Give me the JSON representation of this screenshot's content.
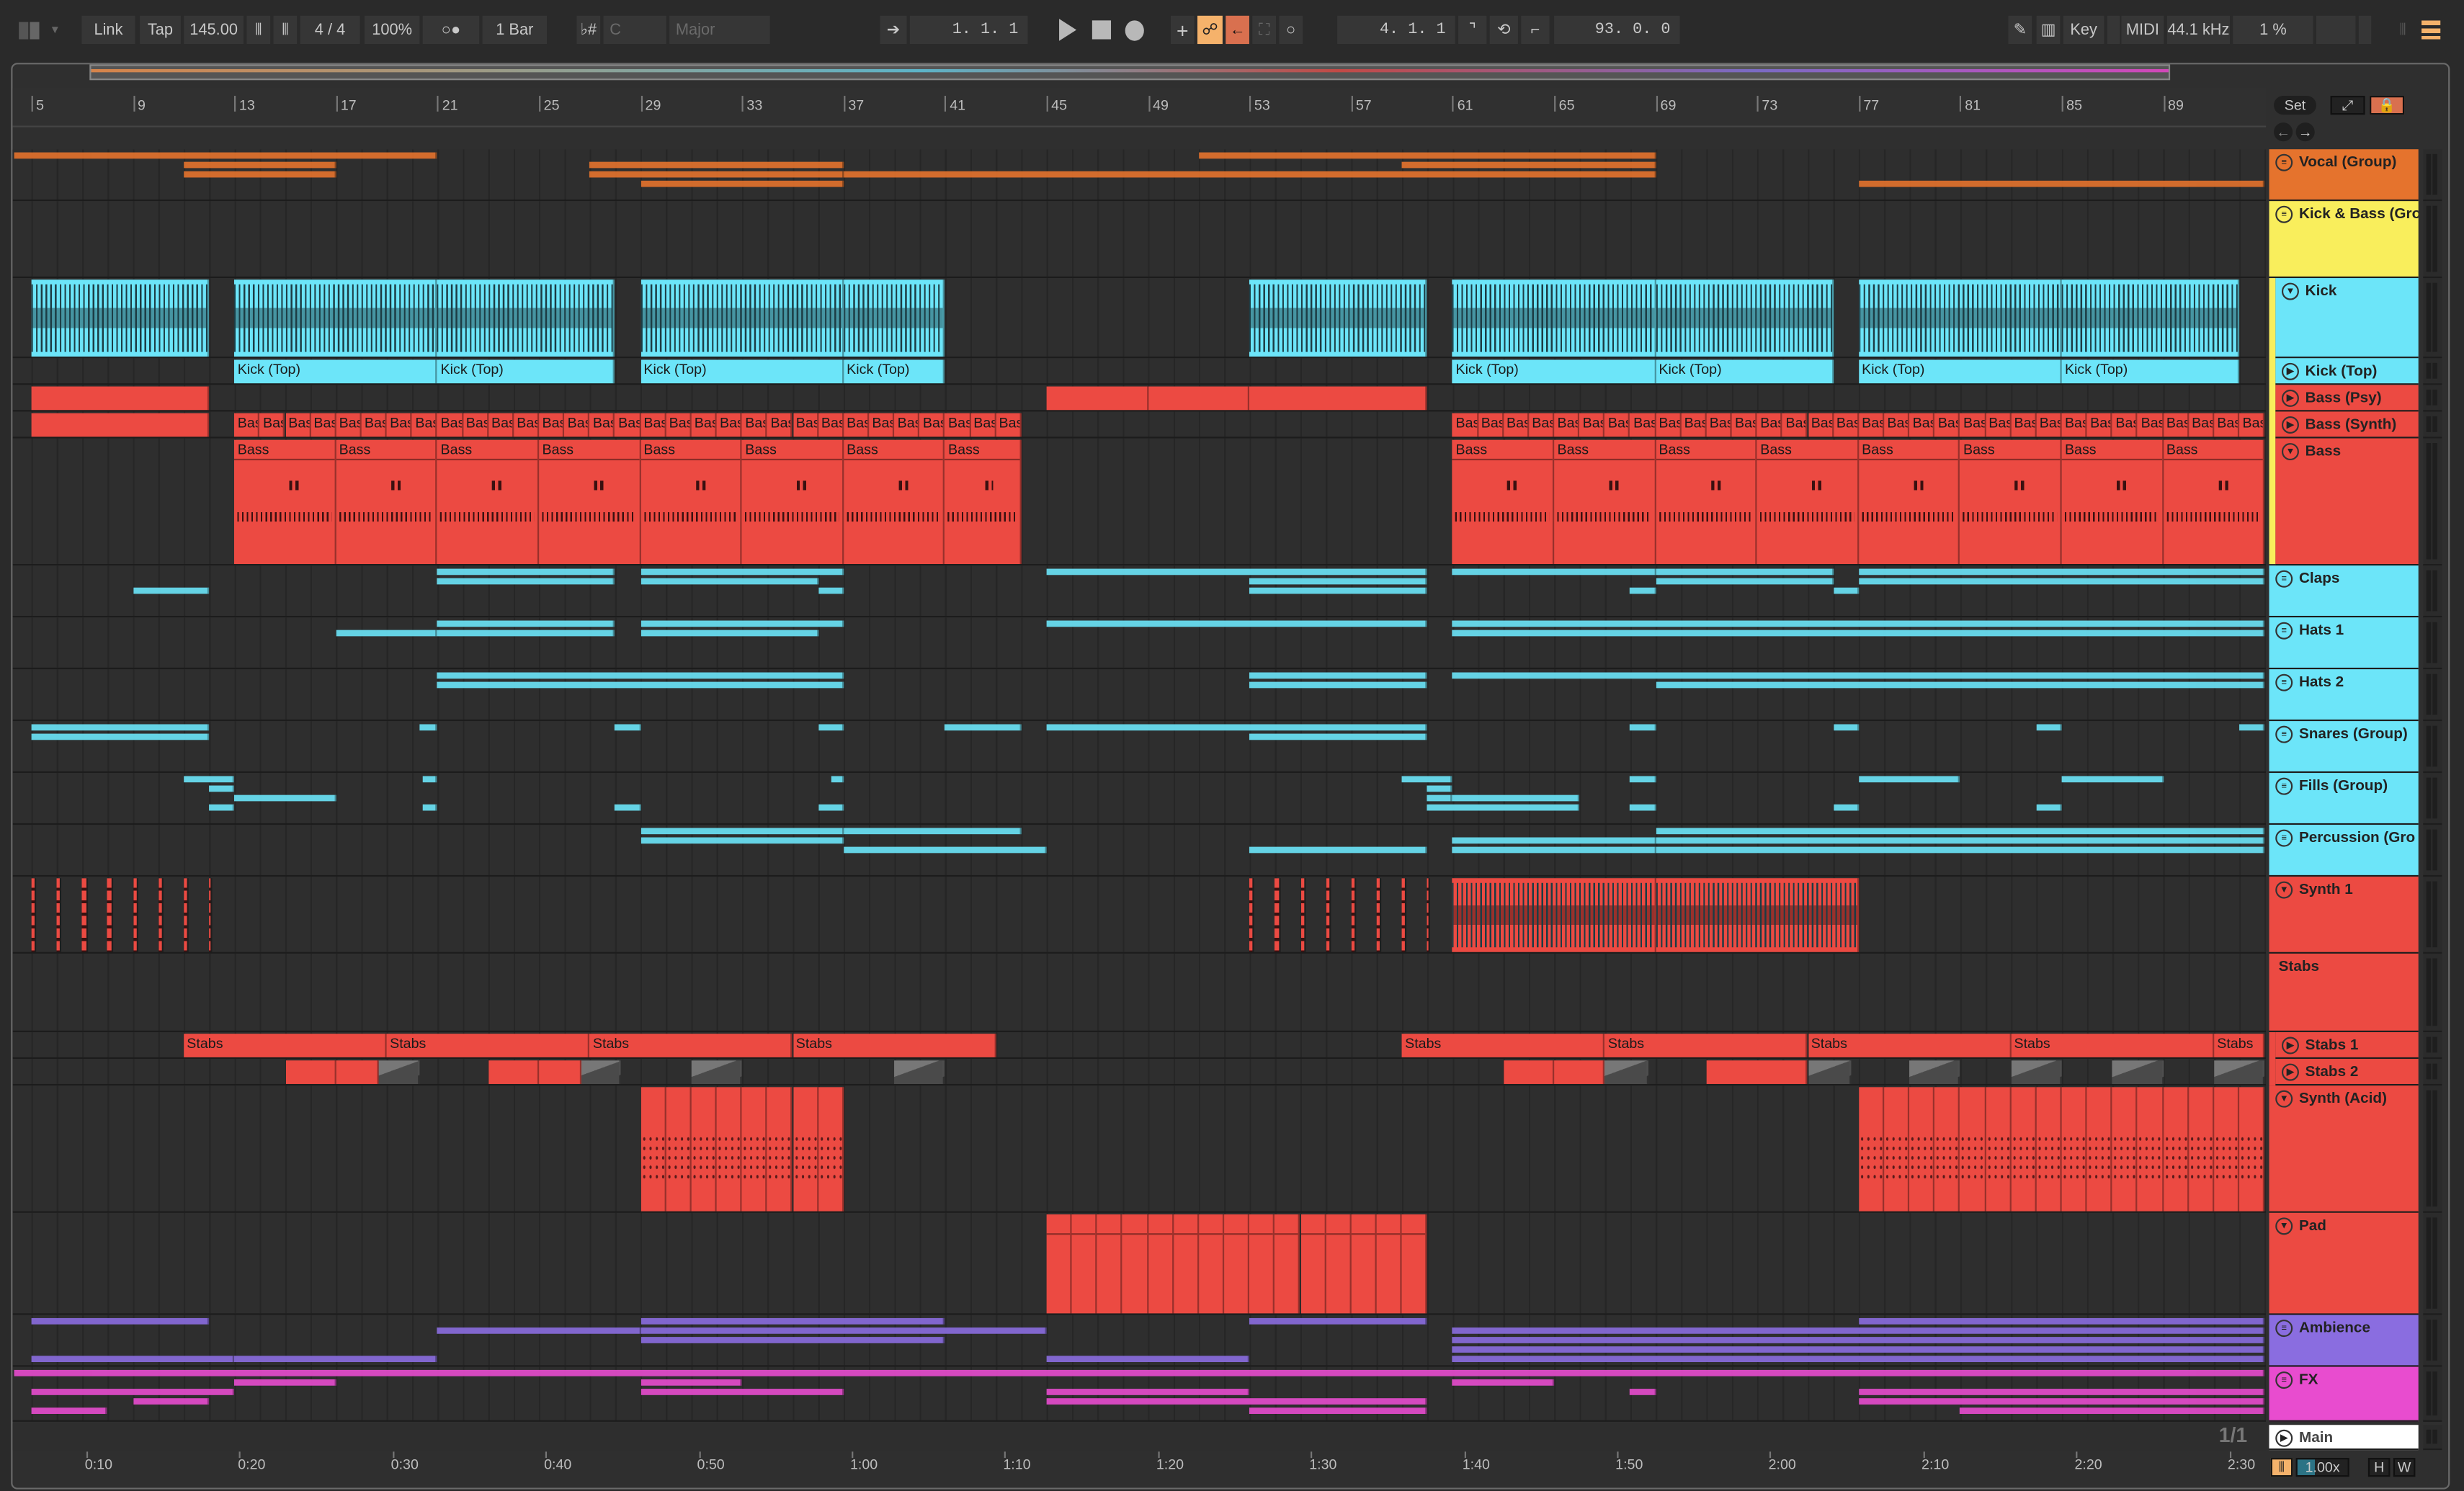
{
  "toolbar": {
    "link": "Link",
    "tap": "Tap",
    "tempo": "145.00",
    "signature": "4 / 4",
    "zoom": "100%",
    "metro": "○●",
    "quantize": "1 Bar",
    "scale_icon": "♭#",
    "key": "C",
    "scale": "Major",
    "position": "1.  1.  1",
    "loop_end": "4.  1.  1",
    "loop_length": "93.  0.  0",
    "key_label": "Key",
    "midi_label": "MIDI",
    "sample_rate": "44.1 kHz",
    "cpu": "1 %",
    "accent_orange": "#f5b26b",
    "accent_red": "#d9704f"
  },
  "browser": {
    "set_label": "Set"
  },
  "ruler_bars": [
    "5",
    "9",
    "13",
    "17",
    "21",
    "25",
    "29",
    "33",
    "37",
    "41",
    "45",
    "49",
    "53",
    "57",
    "61",
    "65",
    "69",
    "73",
    "77",
    "81",
    "85",
    "89"
  ],
  "time_labels": [
    "0:10",
    "0:20",
    "0:30",
    "0:40",
    "0:50",
    "1:00",
    "1:10",
    "1:20",
    "1:30",
    "1:40",
    "1:50",
    "2:00",
    "2:10",
    "2:20",
    "2:30"
  ],
  "page_indicator": "1/1",
  "footer": {
    "zoom_factor": "1.00x",
    "h": "H",
    "w": "W"
  },
  "main_track": {
    "name": "Main"
  },
  "tracks": [
    {
      "name": "Vocal (Group)",
      "color": "#e5732d",
      "icon": "group"
    },
    {
      "name": "Kick & Bass (Gro",
      "color": "#f9ee5c",
      "icon": "group"
    },
    {
      "name": "Kick",
      "color": "#6ce5f9",
      "icon": "expanded",
      "nested": true
    },
    {
      "name": "Kick (Top)",
      "color": "#6ce5f9",
      "icon": "play",
      "nested": true
    },
    {
      "name": "Bass (Psy)",
      "color": "#ec4a42",
      "icon": "play",
      "nested": true
    },
    {
      "name": "Bass (Synth)",
      "color": "#ec4a42",
      "icon": "play",
      "nested": true
    },
    {
      "name": "Bass",
      "color": "#ec4a42",
      "icon": "expanded",
      "nested": true
    },
    {
      "name": "Claps",
      "color": "#6ce5f9",
      "icon": "group"
    },
    {
      "name": "Hats 1",
      "color": "#6ce5f9",
      "icon": "group"
    },
    {
      "name": "Hats 2",
      "color": "#6ce5f9",
      "icon": "group"
    },
    {
      "name": "Snares (Group)",
      "color": "#6ce5f9",
      "icon": "group"
    },
    {
      "name": "Fills (Group)",
      "color": "#6ce5f9",
      "icon": "group"
    },
    {
      "name": "Percussion (Gro",
      "color": "#6ce5f9",
      "icon": "group"
    },
    {
      "name": "Synth 1",
      "color": "#ec4a42",
      "icon": "expanded"
    },
    {
      "name": "Stabs",
      "color": "#ec4a42",
      "icon": "none"
    },
    {
      "name": "Stabs 1",
      "color": "#ec4a42",
      "icon": "play",
      "nested": true
    },
    {
      "name": "Stabs 2",
      "color": "#ec4a42",
      "icon": "play",
      "nested": true
    },
    {
      "name": "Synth (Acid)",
      "color": "#ec4a42",
      "icon": "expanded"
    },
    {
      "name": "Pad",
      "color": "#ec4a42",
      "icon": "expanded"
    },
    {
      "name": "Ambience",
      "color": "#8a6de0",
      "icon": "group"
    },
    {
      "name": "FX",
      "color": "#e84ccf",
      "icon": "group"
    }
  ],
  "clips": [
    {
      "t": 0,
      "lanes": [
        [
          4.3,
          21,
          0
        ],
        [
          11,
          17,
          1
        ],
        [
          11,
          17,
          2
        ],
        [
          27,
          37,
          1
        ],
        [
          27,
          37,
          2
        ],
        [
          29,
          37,
          3
        ],
        [
          37,
          69,
          2
        ],
        [
          51,
          69,
          0
        ],
        [
          59,
          69,
          1
        ],
        [
          77,
          93,
          3
        ]
      ]
    },
    {
      "t": 2,
      "style": "wave",
      "ranges": [
        [
          5,
          12
        ],
        [
          13,
          21
        ],
        [
          21,
          28
        ],
        [
          29,
          37
        ],
        [
          37,
          41
        ],
        [
          53,
          60
        ],
        [
          61,
          69
        ],
        [
          69,
          76
        ],
        [
          77,
          85
        ],
        [
          85,
          92
        ]
      ]
    },
    {
      "t": 3,
      "label": "Kick (Top)",
      "ranges": [
        [
          13,
          21
        ],
        [
          21,
          28
        ],
        [
          29,
          37
        ],
        [
          37,
          41
        ],
        [
          61,
          69
        ],
        [
          69,
          76
        ],
        [
          77,
          85
        ],
        [
          85,
          92
        ]
      ]
    },
    {
      "t": 4,
      "ranges": [
        [
          5,
          12
        ],
        [
          45,
          49
        ],
        [
          49,
          53
        ],
        [
          53,
          60
        ]
      ]
    },
    {
      "t": 5,
      "ranges": [
        [
          5,
          12
        ]
      ]
    },
    {
      "t": 5,
      "label": "Bass",
      "split": 1,
      "ranges": [
        [
          13,
          44
        ],
        [
          61,
          93
        ]
      ]
    },
    {
      "t": 6,
      "label": "Bass",
      "split": 4,
      "style": "midi",
      "ranges": [
        [
          13,
          44
        ],
        [
          61,
          93
        ]
      ]
    },
    {
      "t": 7,
      "lanes": [
        [
          9,
          12,
          2
        ],
        [
          21,
          28,
          0
        ],
        [
          21,
          28,
          1
        ],
        [
          29,
          37,
          0
        ],
        [
          29,
          36,
          1
        ],
        [
          36,
          37,
          2
        ],
        [
          45,
          60,
          0
        ],
        [
          53,
          60,
          1
        ],
        [
          53,
          60,
          2
        ],
        [
          61,
          69,
          0
        ],
        [
          68,
          69,
          2
        ],
        [
          69,
          76,
          0
        ],
        [
          69,
          76,
          1
        ],
        [
          76,
          77,
          2
        ],
        [
          77,
          93,
          0
        ],
        [
          77,
          93,
          1
        ]
      ]
    },
    {
      "t": 8,
      "lanes": [
        [
          17,
          21,
          1
        ],
        [
          21,
          28,
          0
        ],
        [
          21,
          28,
          1
        ],
        [
          29,
          37,
          0
        ],
        [
          29,
          36,
          1
        ],
        [
          45,
          60,
          0
        ],
        [
          61,
          93,
          0
        ],
        [
          61,
          93,
          1
        ]
      ]
    },
    {
      "t": 9,
      "lanes": [
        [
          21,
          37,
          0
        ],
        [
          21,
          37,
          1
        ],
        [
          53,
          60,
          0
        ],
        [
          53,
          60,
          1
        ],
        [
          61,
          93,
          0
        ],
        [
          69,
          93,
          1
        ]
      ]
    },
    {
      "t": 10,
      "lanes": [
        [
          5,
          12,
          0
        ],
        [
          5,
          12,
          1
        ],
        [
          20.3,
          21,
          0
        ],
        [
          28,
          29,
          0
        ],
        [
          36,
          37,
          0
        ],
        [
          41,
          44,
          0
        ],
        [
          45,
          60,
          0
        ],
        [
          53,
          60,
          1
        ],
        [
          68,
          69,
          0
        ],
        [
          76,
          77,
          0
        ],
        [
          84,
          85,
          0
        ],
        [
          92,
          93,
          0
        ]
      ]
    },
    {
      "t": 11,
      "lanes": [
        [
          11,
          13,
          0
        ],
        [
          12,
          13,
          1
        ],
        [
          13,
          17,
          2
        ],
        [
          12,
          13,
          3
        ],
        [
          20.4,
          21,
          0
        ],
        [
          20.4,
          21,
          3
        ],
        [
          28,
          29,
          3
        ],
        [
          36.5,
          37,
          0
        ],
        [
          36,
          37,
          3
        ],
        [
          59,
          61,
          0
        ],
        [
          60,
          61,
          1
        ],
        [
          60,
          61,
          2
        ],
        [
          61,
          66,
          2
        ],
        [
          60,
          66,
          3
        ],
        [
          68,
          69,
          0
        ],
        [
          68,
          69,
          3
        ],
        [
          77,
          81,
          0
        ],
        [
          76,
          77,
          3
        ],
        [
          85,
          89,
          0
        ],
        [
          84,
          85,
          3
        ]
      ]
    },
    {
      "t": 12,
      "lanes": [
        [
          29,
          37,
          0
        ],
        [
          29,
          37,
          1
        ],
        [
          37,
          44,
          0
        ],
        [
          37,
          45,
          2
        ],
        [
          53,
          60,
          2
        ],
        [
          61,
          69,
          1
        ],
        [
          61,
          69,
          2
        ],
        [
          69,
          93,
          0
        ],
        [
          69,
          93,
          1
        ],
        [
          69,
          93,
          2
        ]
      ]
    },
    {
      "t": 13,
      "style": "spikes",
      "split": 1,
      "ranges": [
        [
          5,
          12.3
        ],
        [
          53,
          60.3
        ]
      ]
    },
    {
      "t": 13,
      "style": "wave",
      "ranges": [
        [
          61,
          69
        ],
        [
          69,
          77
        ]
      ]
    },
    {
      "t": 15,
      "label": "Stabs",
      "ranges": [
        [
          11,
          19
        ],
        [
          19,
          27
        ],
        [
          27,
          35
        ],
        [
          35,
          43
        ],
        [
          59,
          67
        ],
        [
          67,
          75
        ],
        [
          75,
          83
        ],
        [
          83,
          91
        ],
        [
          91,
          93
        ]
      ]
    },
    {
      "t": 16,
      "ranges": [
        [
          15,
          17
        ],
        [
          17,
          18.7
        ],
        [
          23,
          25
        ],
        [
          25,
          26.7
        ],
        [
          63,
          65
        ],
        [
          65,
          67
        ],
        [
          71,
          75
        ]
      ]
    },
    {
      "t": 16,
      "style": "grey",
      "ranges": [
        [
          18.7,
          20.3
        ],
        [
          26.7,
          28.2
        ],
        [
          31,
          33
        ],
        [
          39,
          41
        ],
        [
          67,
          68.7
        ],
        [
          75,
          76.7
        ],
        [
          79,
          81
        ],
        [
          83,
          85
        ],
        [
          87,
          89
        ],
        [
          91,
          93
        ]
      ]
    },
    {
      "t": 17,
      "style": "dots",
      "split": 1,
      "ranges": [
        [
          29,
          37
        ],
        [
          77,
          93
        ]
      ]
    },
    {
      "t": 18,
      "split": 1,
      "style": "pad",
      "ranges": [
        [
          45,
          60
        ]
      ]
    },
    {
      "t": 19,
      "lanes": [
        [
          5,
          12,
          0
        ],
        [
          21,
          29,
          1
        ],
        [
          29,
          41,
          0
        ],
        [
          29,
          45,
          1
        ],
        [
          29,
          41,
          2
        ],
        [
          5,
          13,
          4
        ],
        [
          13,
          21,
          4
        ],
        [
          45,
          53,
          4
        ],
        [
          53,
          60,
          0
        ],
        [
          61,
          93,
          1
        ],
        [
          61,
          93,
          2
        ],
        [
          61,
          93,
          3
        ],
        [
          61,
          93,
          4
        ],
        [
          77,
          93,
          0
        ]
      ]
    },
    {
      "t": 20,
      "lanes": [
        [
          4.3,
          93,
          0
        ],
        [
          5,
          13,
          2
        ],
        [
          9,
          12,
          3
        ],
        [
          5,
          8,
          4
        ],
        [
          13,
          17,
          1
        ],
        [
          29,
          33,
          1
        ],
        [
          29,
          37,
          2
        ],
        [
          45,
          53,
          2
        ],
        [
          45,
          60,
          3
        ],
        [
          53,
          60,
          4
        ],
        [
          61,
          65,
          1
        ],
        [
          68,
          69,
          2
        ],
        [
          77,
          93,
          2
        ],
        [
          77,
          93,
          3
        ],
        [
          81,
          93,
          4
        ]
      ]
    }
  ]
}
